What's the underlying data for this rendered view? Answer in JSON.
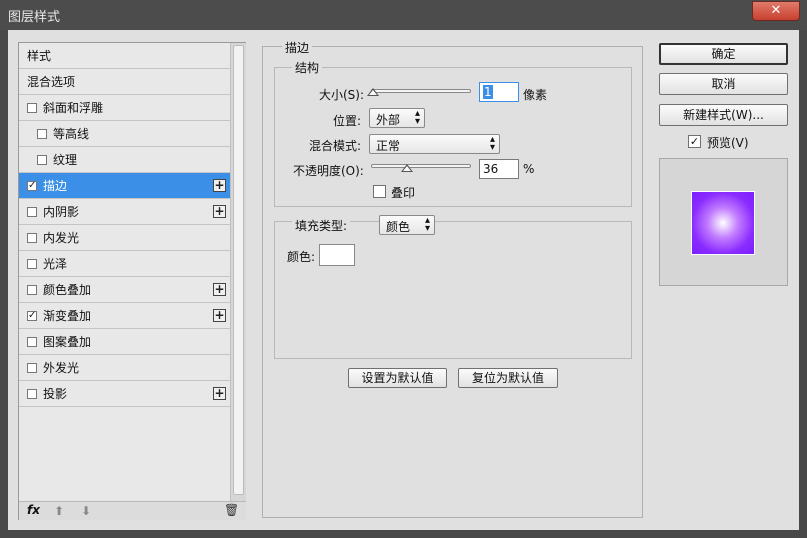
{
  "window": {
    "title": "图层样式",
    "close_label": "✕"
  },
  "styles_list": {
    "items": [
      {
        "label": "样式",
        "checked": null,
        "plus": false,
        "indent": false,
        "selected": false
      },
      {
        "label": "混合选项",
        "checked": null,
        "plus": false,
        "indent": false,
        "selected": false
      },
      {
        "label": "斜面和浮雕",
        "checked": false,
        "plus": false,
        "indent": false,
        "selected": false
      },
      {
        "label": "等高线",
        "checked": false,
        "plus": false,
        "indent": true,
        "selected": false
      },
      {
        "label": "纹理",
        "checked": false,
        "plus": false,
        "indent": true,
        "selected": false
      },
      {
        "label": "描边",
        "checked": true,
        "plus": true,
        "indent": false,
        "selected": true
      },
      {
        "label": "内阴影",
        "checked": false,
        "plus": true,
        "indent": false,
        "selected": false
      },
      {
        "label": "内发光",
        "checked": false,
        "plus": false,
        "indent": false,
        "selected": false
      },
      {
        "label": "光泽",
        "checked": false,
        "plus": false,
        "indent": false,
        "selected": false
      },
      {
        "label": "颜色叠加",
        "checked": false,
        "plus": true,
        "indent": false,
        "selected": false
      },
      {
        "label": "渐变叠加",
        "checked": true,
        "plus": true,
        "indent": false,
        "selected": false
      },
      {
        "label": "图案叠加",
        "checked": false,
        "plus": false,
        "indent": false,
        "selected": false
      },
      {
        "label": "外发光",
        "checked": false,
        "plus": false,
        "indent": false,
        "selected": false
      },
      {
        "label": "投影",
        "checked": false,
        "plus": true,
        "indent": false,
        "selected": false
      }
    ],
    "footer": {
      "fx_label": "fx",
      "up_glyph": "⬆",
      "down_glyph": "⬇",
      "trash_glyph": "🗑"
    }
  },
  "stroke": {
    "section_title": "描边",
    "structure_title": "结构",
    "size_label": "大小(S):",
    "size_value": "1",
    "size_unit": "像素",
    "size_fraction": 0.0,
    "position_label": "位置:",
    "position_value": "外部",
    "blend_label": "混合模式:",
    "blend_value": "正常",
    "opacity_label": "不透明度(O):",
    "opacity_value": "36",
    "opacity_unit": "%",
    "opacity_fraction": 0.36,
    "overprint_label": "叠印",
    "overprint_checked": false,
    "fill_type_label": "填充类型:",
    "fill_type_value": "颜色",
    "color_label": "颜色:",
    "color_value": "#ffffff"
  },
  "defaults": {
    "set_default": "设置为默认值",
    "reset_default": "复位为默认值"
  },
  "right": {
    "ok": "确定",
    "cancel": "取消",
    "new_style": "新建样式(W)...",
    "preview_label": "预览(V)",
    "preview_checked": true
  },
  "colors": {
    "selected_row": "#3b8fe6",
    "preview_center": "#ffffff",
    "preview_edge": "#7d1fff"
  }
}
